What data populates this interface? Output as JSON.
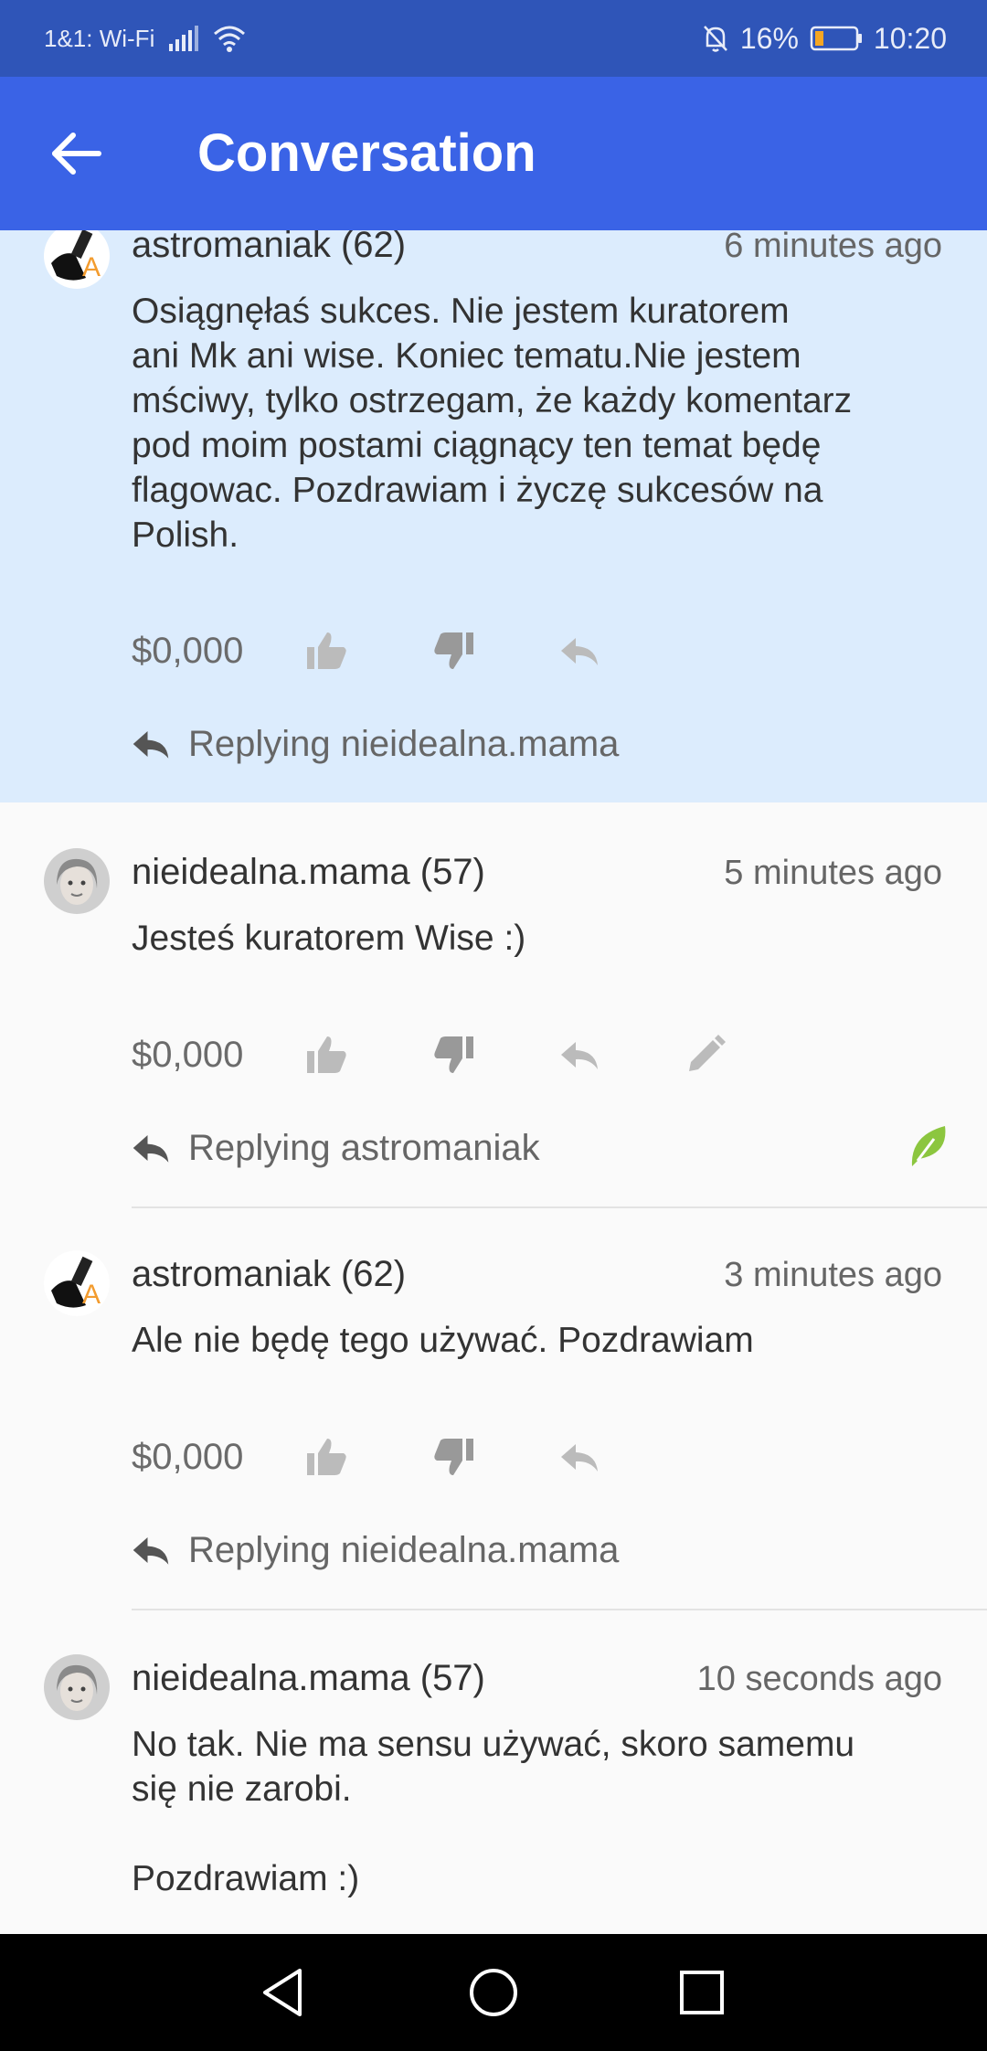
{
  "status_bar": {
    "carrier": "1&1: Wi-Fi",
    "battery": "16%",
    "time": "10:20",
    "icons": [
      "signal-icon",
      "wifi-icon",
      "mute-bell-icon",
      "battery-icon"
    ]
  },
  "app_bar": {
    "title": "Conversation",
    "back_icon": "arrow-left-icon"
  },
  "comments": [
    {
      "author": "astromaniak (62)",
      "time": "6 minutes ago",
      "body": "Osiągnęłaś sukces. Nie jestem kuratorem\nani Mk ani wise. Koniec tematu.Nie jestem\nmściwy, tylko ostrzegam, że każdy komentarz\npod moim postami ciągnący ten temat będę\nflagowac. Pozdrawiam i życzę sukcesów na\nPolish.",
      "payout": "$0,000",
      "replying": "Replying nieidealna.mama",
      "highlighted": true
    },
    {
      "author": "nieidealna.mama (57)",
      "time": "5 minutes ago",
      "body": "Jesteś kuratorem Wise :)",
      "payout": "$0,000",
      "replying": "Replying astromaniak",
      "editable": true
    },
    {
      "author": "astromaniak (62)",
      "time": "3 minutes ago",
      "body": "Ale nie będę tego używać. Pozdrawiam",
      "payout": "$0,000",
      "replying": "Replying nieidealna.mama"
    },
    {
      "author": "nieidealna.mama (57)",
      "time": "10 seconds ago",
      "body": "No tak. Nie ma sensu używać, skoro samemu\nsię nie zarobi.\n\nPozdrawiam :)"
    }
  ],
  "colors": {
    "status_bar": "#2f55b8",
    "app_bar": "#3a63e6",
    "highlight": "#dcecfd",
    "leaf_accent": "#8cc63f"
  },
  "nav_bar": {
    "icons": [
      "back-triangle-icon",
      "home-circle-icon",
      "recents-square-icon"
    ]
  }
}
